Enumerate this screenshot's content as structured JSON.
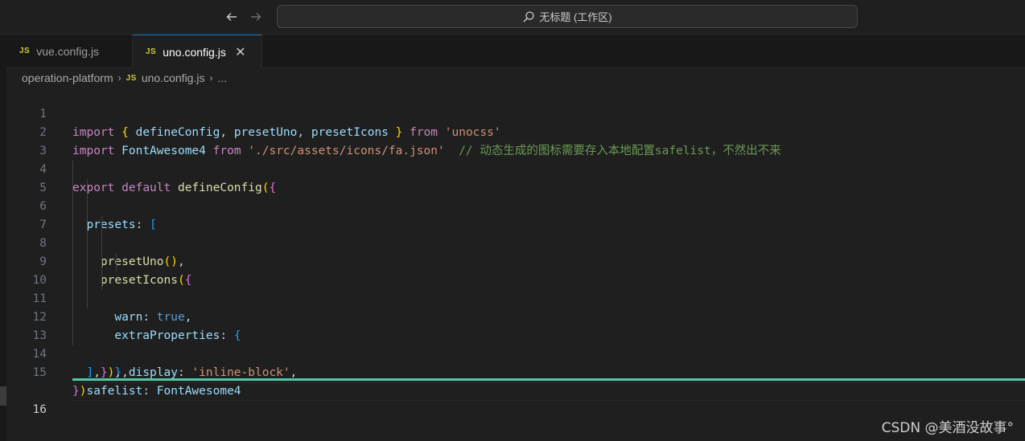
{
  "titlebar": {
    "back_icon": "arrow-left-icon",
    "forward_icon": "arrow-right-icon",
    "search_icon": "search-icon",
    "command_center_text": "无标题 (工作区)"
  },
  "tabs": [
    {
      "icon": "JS",
      "label": "vue.config.js",
      "active": false
    },
    {
      "icon": "JS",
      "label": "uno.config.js",
      "active": true,
      "close": "✕"
    }
  ],
  "breadcrumb": {
    "folder": "operation-platform",
    "sep": "›",
    "file_icon": "JS",
    "file": "uno.config.js",
    "symbol": "..."
  },
  "editor": {
    "line_numbers": [
      "1",
      "2",
      "3",
      "4",
      "5",
      "6",
      "7",
      "8",
      "9",
      "10",
      "11",
      "12",
      "13",
      "14",
      "15",
      "16"
    ],
    "current_line": 16,
    "lines": [
      "import { defineConfig, presetUno, presetIcons } from 'unocss'",
      "import FontAwesome4 from './src/assets/icons/fa.json'  // 动态生成的图标需要存入本地配置safelist，不然出不来",
      "",
      "export default defineConfig({",
      "  presets: [",
      "    presetUno(),",
      "    presetIcons({",
      "      warn: true,",
      "      extraProperties: {",
      "        display: 'inline-block',",
      "      },",
      "    }),",
      "  ],",
      "  safelist: FontAwesome4",
      "})",
      ""
    ]
  },
  "watermark": "CSDN @美酒没故事°",
  "colors": {
    "background": "#1f1f1f",
    "keyword": "#c586c0",
    "function": "#dcdcaa",
    "variable": "#9cdcfe",
    "string": "#ce9178",
    "comment": "#6a9955",
    "constant": "#569cd6",
    "active_tab_border": "#0078d4",
    "status_bar_accent": "#4ec9a8"
  }
}
